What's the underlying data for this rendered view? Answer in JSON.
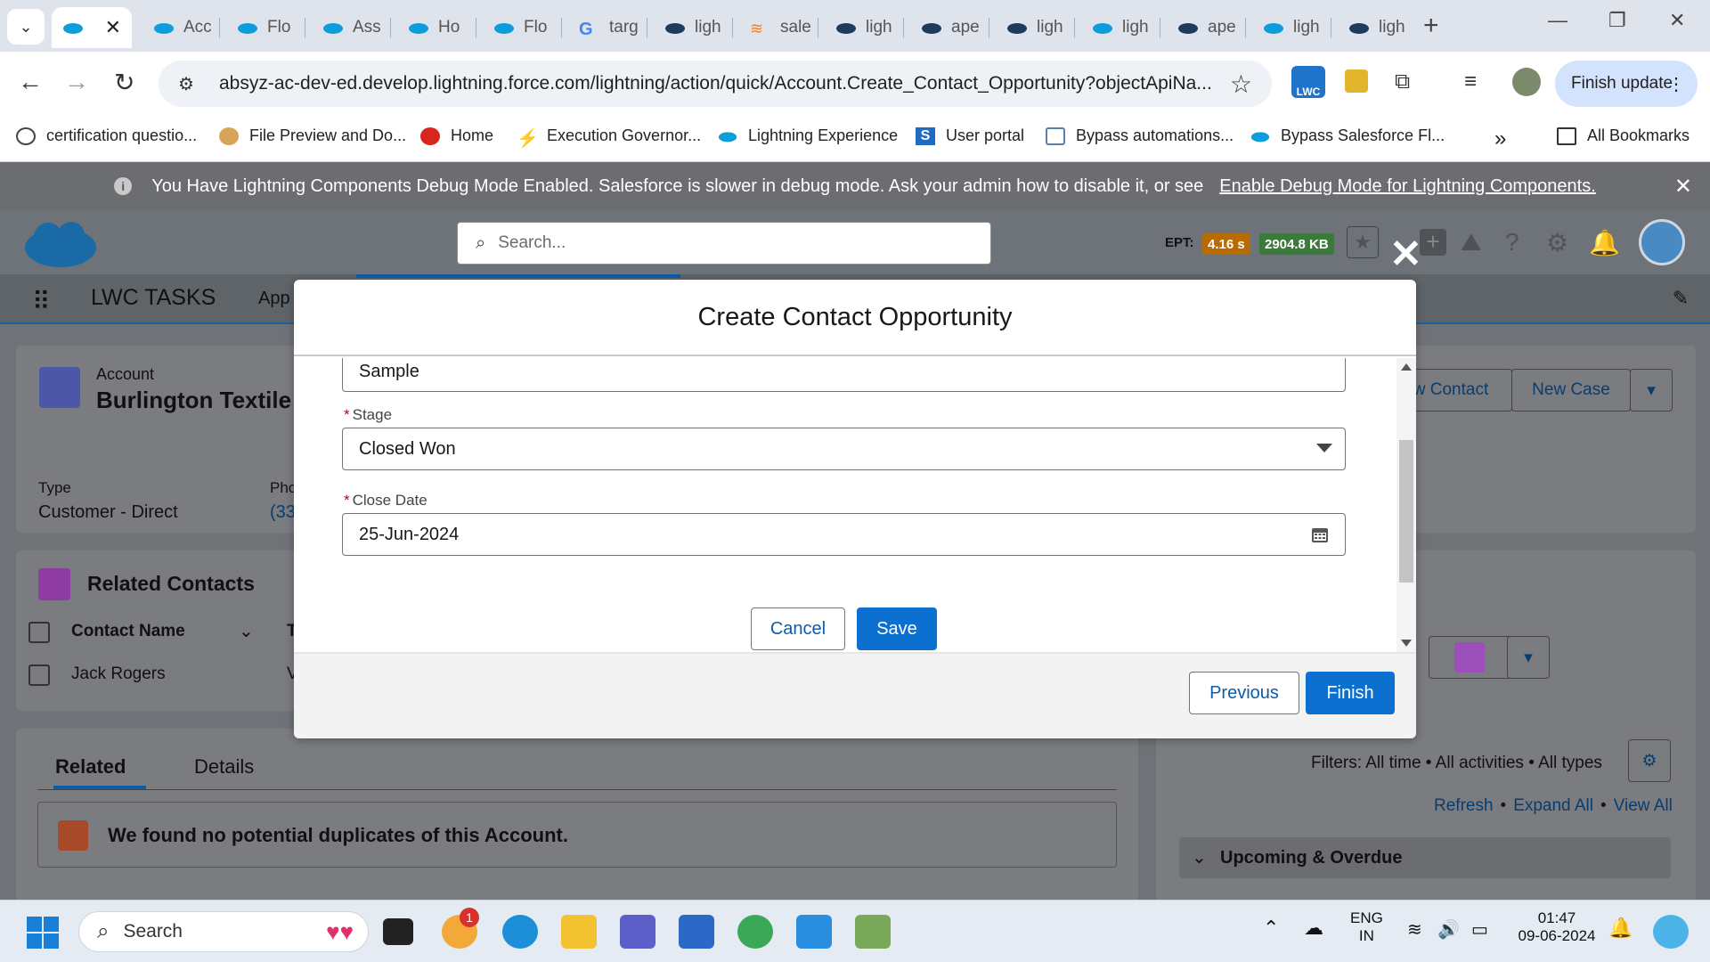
{
  "browser": {
    "tabs": [
      {
        "label": "",
        "active": true
      },
      {
        "label": "Acc"
      },
      {
        "label": "Flo"
      },
      {
        "label": "Ass"
      },
      {
        "label": "Ho"
      },
      {
        "label": "Flo"
      },
      {
        "label": "targ"
      },
      {
        "label": "ligh"
      },
      {
        "label": "sale"
      },
      {
        "label": "ligh"
      },
      {
        "label": "ape"
      },
      {
        "label": "ligh"
      },
      {
        "label": "ligh"
      },
      {
        "label": "ape"
      },
      {
        "label": "ligh"
      },
      {
        "label": "ligh"
      }
    ],
    "url": "absyz-ac-dev-ed.develop.lightning.force.com/lightning/action/quick/Account.Create_Contact_Opportunity?objectApiNa...",
    "finish_update_label": "Finish update",
    "ext_lwc_label": "LWC",
    "bookmarks": [
      "certification questio...",
      "File Preview and Do...",
      "Home",
      "Execution Governor...",
      "Lightning Experience",
      "User portal",
      "Bypass automations...",
      "Bypass Salesforce Fl..."
    ],
    "more_bookmarks": "»",
    "all_bookmarks": "All Bookmarks"
  },
  "debug_banner": {
    "message": "You Have Lightning Components Debug Mode Enabled. Salesforce is slower in debug mode. Ask your admin how to disable it, or see",
    "link": "Enable Debug Mode for Lightning Components."
  },
  "sf_header": {
    "search_placeholder": "Search...",
    "ept_label": "EPT:",
    "ept_time": "4.16 s",
    "ept_size": "2904.8 KB",
    "app_name": "LWC TASKS",
    "nav_item": "App"
  },
  "record": {
    "object_label": "Account",
    "name": "Burlington Textile",
    "type_label": "Type",
    "type_value": "Customer - Direct",
    "phone_label": "Pho",
    "phone_value": "(33",
    "actions": [
      "w Contact",
      "New Case"
    ]
  },
  "related_contacts": {
    "title": "Related Contacts",
    "column_header": "Contact Name",
    "column_header_2": "T",
    "rows": [
      {
        "name": "Jack Rogers",
        "col2": "V"
      }
    ]
  },
  "lower_tabs": {
    "related": "Related",
    "details": "Details",
    "duplicates_msg": "We found no potential duplicates of this Account."
  },
  "activity": {
    "filters": "Filters: All time • All activities • All types",
    "refresh": "Refresh",
    "expand_all": "Expand All",
    "view_all": "View All",
    "sep": "•",
    "section": "Upcoming & Overdue"
  },
  "modal": {
    "title": "Create Contact Opportunity",
    "name_value": "Sample",
    "stage_label": "Stage",
    "stage_value": "Closed Won",
    "close_date_label": "Close Date",
    "close_date_value": "25-Jun-2024",
    "required_mark": "*",
    "cancel_label": "Cancel",
    "save_label": "Save",
    "previous_label": "Previous",
    "finish_label": "Finish"
  },
  "taskbar": {
    "search_label": "Search",
    "lang_line1": "ENG",
    "lang_line2": "IN",
    "time": "01:47",
    "date": "09-06-2024",
    "notification_count": "1"
  },
  "colors": {
    "brand_blue": "#0b70d0",
    "ept_time_bg": "#b86b00",
    "ept_size_bg": "#3c7a3c",
    "required_red": "#ba0517"
  }
}
